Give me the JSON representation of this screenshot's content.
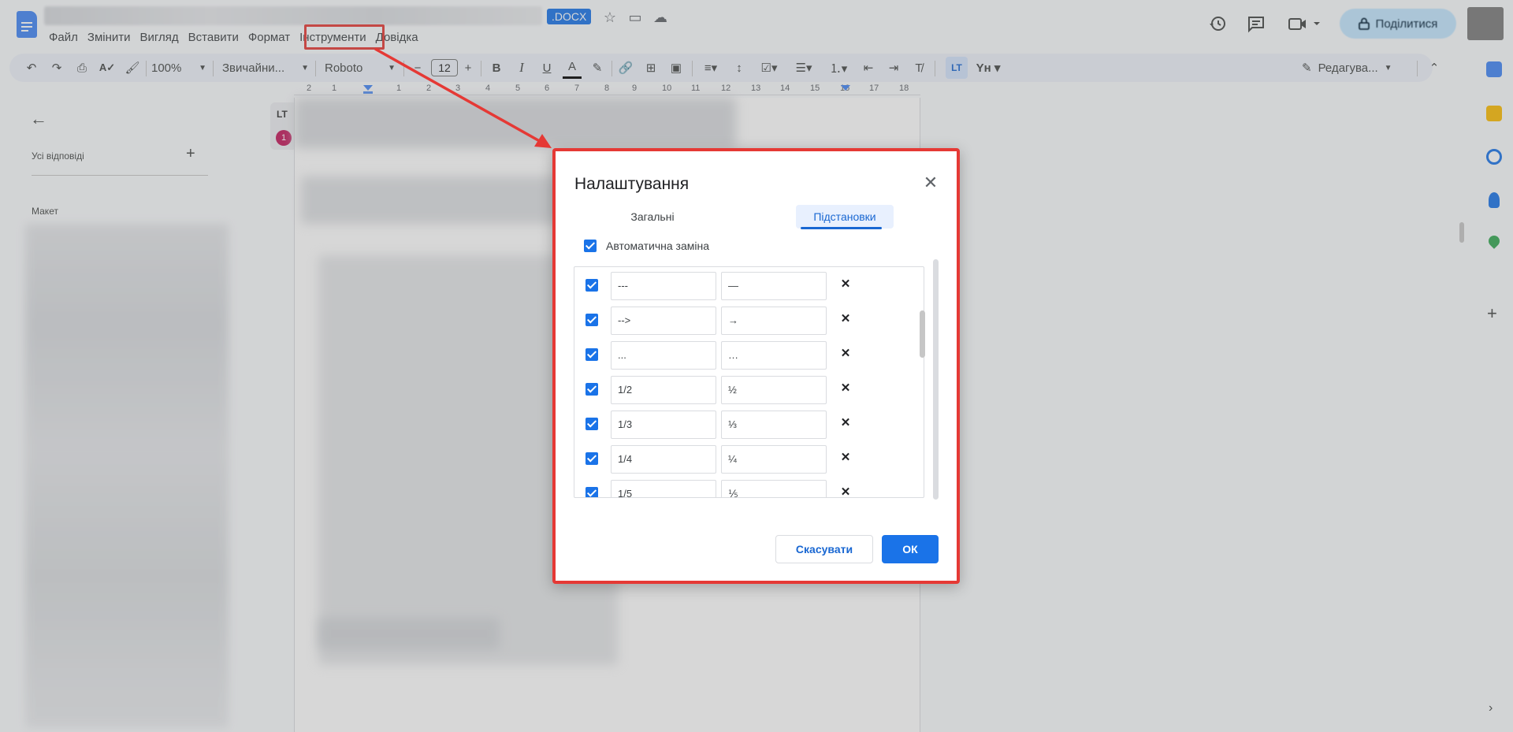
{
  "header": {
    "doc_badge": ".DOCX",
    "menu": [
      "Файл",
      "Змінити",
      "Вигляд",
      "Вставити",
      "Формат",
      "Інструменти",
      "Довідка"
    ],
    "share_label": "Поділитися"
  },
  "toolbar": {
    "zoom": "100%",
    "style": "Звичайни...",
    "font": "Roboto",
    "font_size": "12",
    "editing_mode": "Редагува..."
  },
  "ruler": {
    "ticks": [
      "2",
      "1",
      "1",
      "2",
      "3",
      "4",
      "5",
      "6",
      "7",
      "8",
      "9",
      "10",
      "11",
      "12",
      "13",
      "14",
      "15",
      "16",
      "17",
      "18"
    ]
  },
  "left_panel": {
    "all_replies": "Усі відповіді",
    "layout_label": "Макет",
    "lt_badge_text": "LT",
    "lt_count": "1"
  },
  "dialog": {
    "title": "Налаштування",
    "tabs": [
      "Загальні",
      "Підстановки"
    ],
    "active_tab": "Підстановки",
    "auto_replace_label": "Автоматична заміна",
    "substitutions": [
      {
        "from": "---",
        "to": "—"
      },
      {
        "from": "-->",
        "to": "→"
      },
      {
        "from": "...",
        "to": "…"
      },
      {
        "from": "1/2",
        "to": "½"
      },
      {
        "from": "1/3",
        "to": "⅓"
      },
      {
        "from": "1/4",
        "to": "¼"
      },
      {
        "from": "1/5",
        "to": "⅕"
      }
    ],
    "cancel_label": "Скасувати",
    "ok_label": "ОК"
  },
  "colors": {
    "accent": "#1a73e8",
    "highlight_frame": "#e53935",
    "share_bg": "#c2e7ff"
  },
  "icons": {
    "history": "history-icon",
    "comments": "comment-icon",
    "meet": "video-camera-icon",
    "lock": "lock-icon"
  }
}
